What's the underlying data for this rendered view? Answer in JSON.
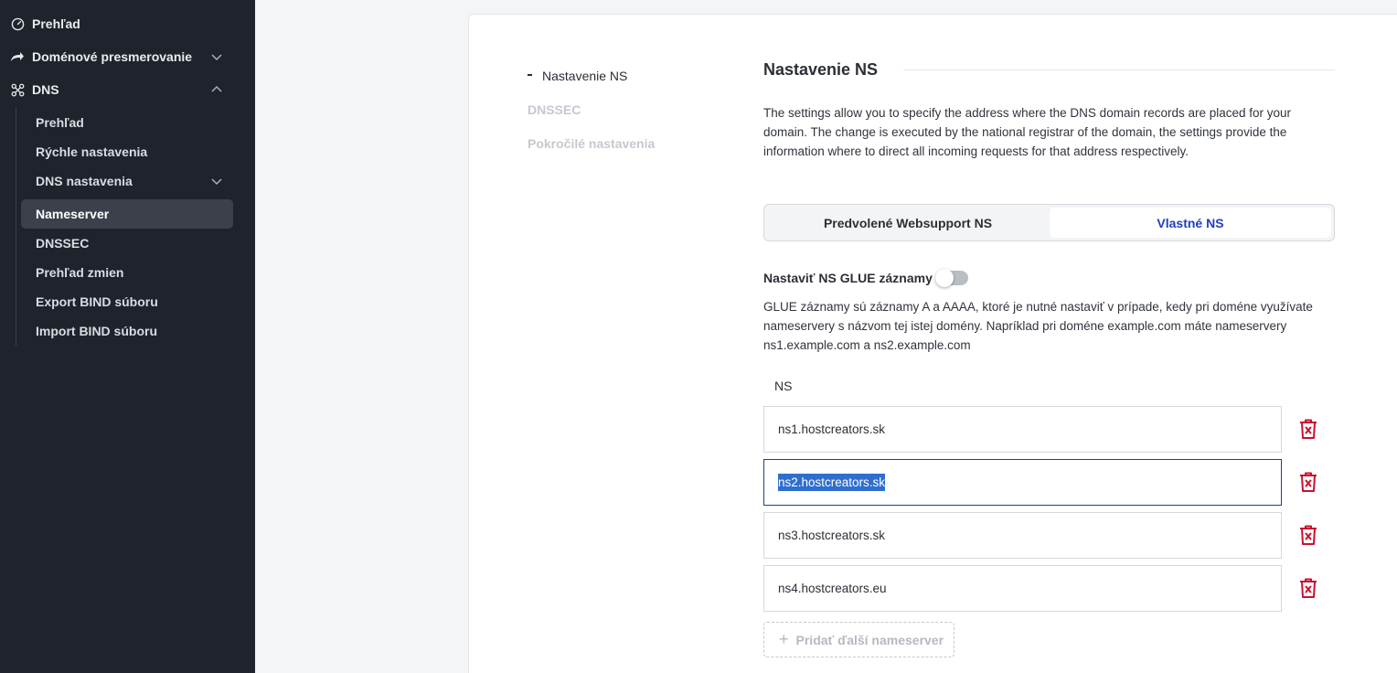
{
  "sidebar": {
    "top_items": [
      {
        "label": "Prehľad",
        "icon": "gauge-icon"
      },
      {
        "label": "Doménové presmerovanie",
        "icon": "redirect-arrow-icon"
      },
      {
        "label": "DNS",
        "icon": "dns-network-icon"
      }
    ],
    "dns_sub_items": [
      {
        "label": "Prehľad"
      },
      {
        "label": "Rýchle nastavenia"
      },
      {
        "label": "DNS nastavenia"
      },
      {
        "label": "Nameserver"
      },
      {
        "label": "DNSSEC"
      },
      {
        "label": "Prehľad zmien"
      },
      {
        "label": "Export BIND súboru"
      },
      {
        "label": "Import BIND súboru"
      }
    ],
    "active_item": "Nameserver"
  },
  "anchors": [
    {
      "label": "Nastavenie NS",
      "active": true
    },
    {
      "label": "DNSSEC",
      "active": false
    },
    {
      "label": "Pokročilé nastavenia",
      "active": false
    }
  ],
  "section": {
    "title": "Nastavenie NS",
    "description_lines": [
      "The settings allow you to specify the address where the DNS domain records are placed for your",
      "domain. The change is executed by the national registrar of the domain, the settings provide the",
      "information where to direct all incoming requests for that address respectively."
    ]
  },
  "ns_mode": {
    "options": [
      "Predvolené Websupport NS",
      "Vlastné NS"
    ],
    "selected": "Vlastné NS"
  },
  "glue": {
    "label": "Nastaviť NS GLUE záznamy",
    "enabled": false,
    "description_lines": [
      "GLUE záznamy sú záznamy A a AAAA, ktoré je nutné nastaviť v prípade, kedy pri doméne využívate",
      "nameservery s názvom tej istej domény. Napríklad pri doméne example.com máte nameservery",
      "ns1.example.com a ns2.example.com"
    ]
  },
  "nameservers": {
    "label": "NS",
    "entries": [
      "ns1.hostcreators.sk",
      "ns2.hostcreators.sk",
      "ns3.hostcreators.sk",
      "ns4.hostcreators.eu"
    ],
    "focused_index": 1,
    "add_label": "Pridať ďalší nameserver"
  },
  "colors": {
    "sidebar_bg": "#1e232c",
    "accent": "#1f3fbf",
    "danger": "#c8102e",
    "selection": "#2f6ecf"
  }
}
